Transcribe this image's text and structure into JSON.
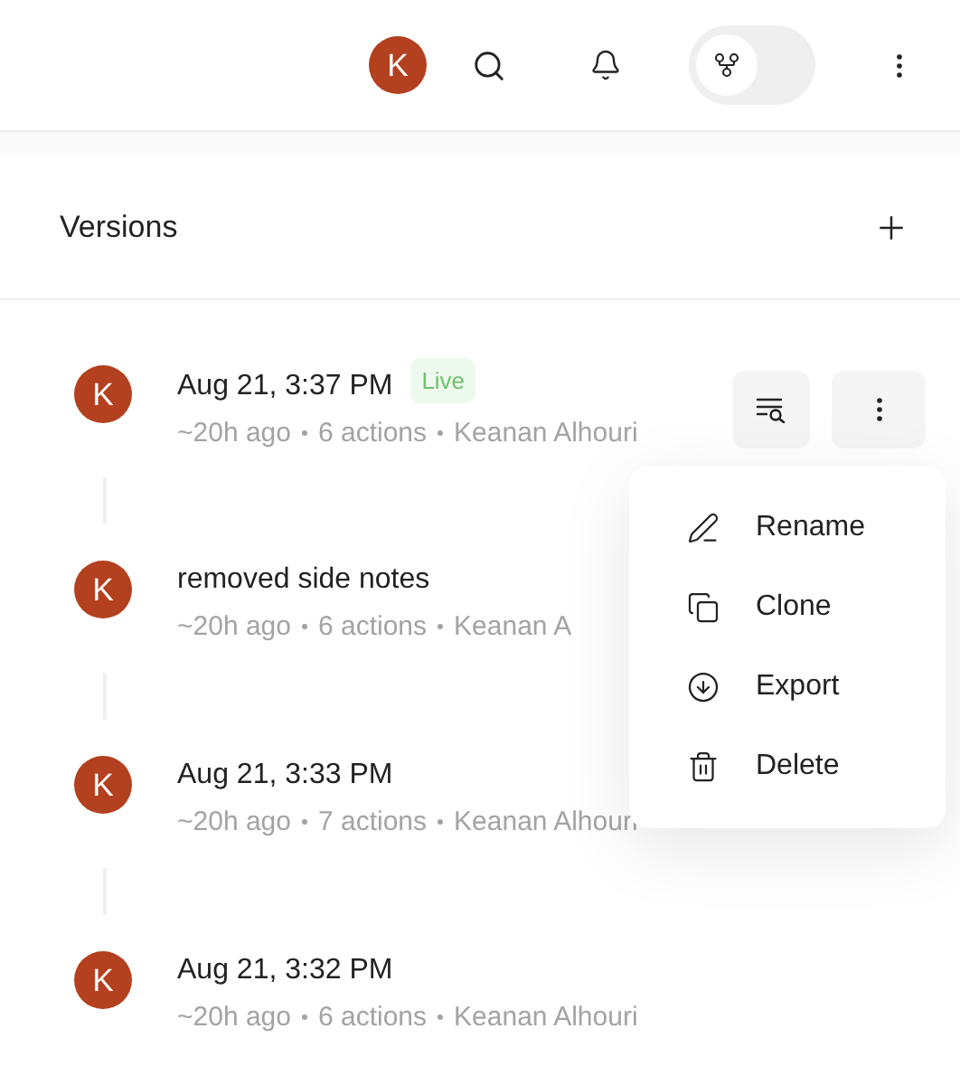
{
  "topbar": {
    "avatar": "K",
    "branch_toggle": {
      "on": false
    }
  },
  "panel": {
    "title": "Versions"
  },
  "versions": [
    {
      "avatar": "K",
      "title": "Aug 21, 3:37 PM",
      "badge": "Live",
      "meta": [
        "~20h ago",
        "6 actions",
        "Keanan Alhouri"
      ],
      "actions_shown": true
    },
    {
      "avatar": "K",
      "title": "removed side notes",
      "meta": [
        "~20h ago",
        "6 actions",
        "Keanan A"
      ]
    },
    {
      "avatar": "K",
      "title": "Aug 21, 3:33 PM",
      "meta": [
        "~20h ago",
        "7 actions",
        "Keanan Alhouri"
      ]
    },
    {
      "avatar": "K",
      "title": "Aug 21, 3:32 PM",
      "meta": [
        "~20h ago",
        "6 actions",
        "Keanan Alhouri"
      ]
    }
  ],
  "menu": [
    {
      "kind": "rename",
      "label": "Rename"
    },
    {
      "kind": "clone",
      "label": "Clone"
    },
    {
      "kind": "export",
      "label": "Export"
    },
    {
      "kind": "delete",
      "label": "Delete"
    }
  ]
}
